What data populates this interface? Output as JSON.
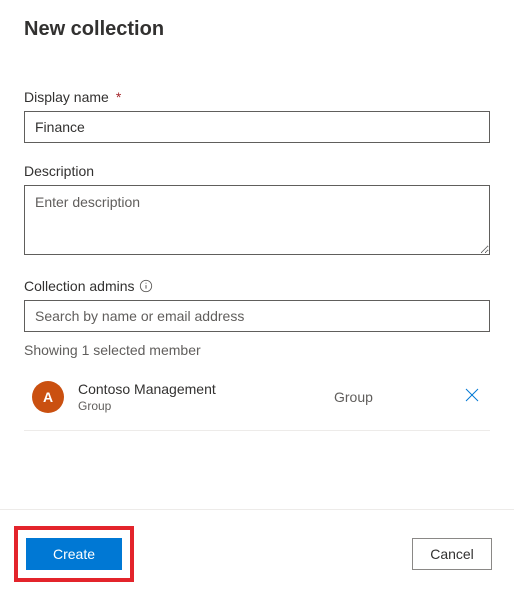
{
  "title": "New collection",
  "displayName": {
    "label": "Display name",
    "required": "*",
    "value": "Finance"
  },
  "description": {
    "label": "Description",
    "placeholder": "Enter description",
    "value": ""
  },
  "admins": {
    "label": "Collection admins",
    "placeholder": "Search by name or email address",
    "status": "Showing 1 selected member",
    "members": [
      {
        "avatarInitial": "A",
        "name": "Contoso Management",
        "subtype": "Group",
        "type": "Group"
      }
    ]
  },
  "footer": {
    "create": "Create",
    "cancel": "Cancel"
  }
}
